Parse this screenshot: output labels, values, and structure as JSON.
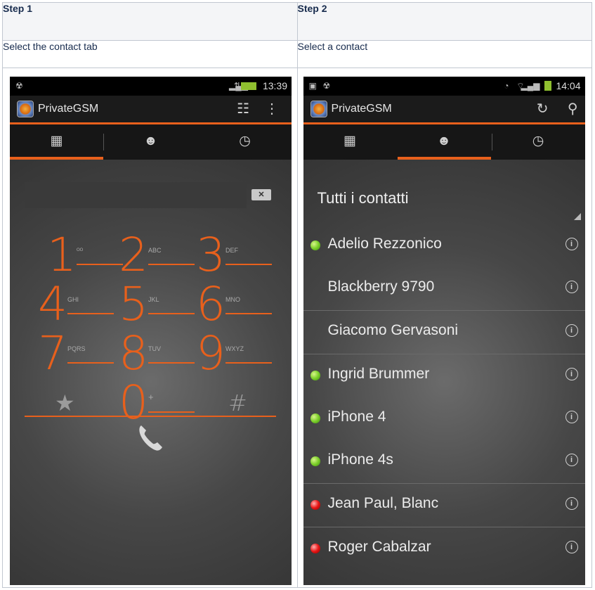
{
  "table": {
    "headers": [
      "Step 1",
      "Step 2"
    ],
    "descriptions": [
      "Select the contact tab",
      "Select a contact"
    ]
  },
  "phone1": {
    "status_time": "13:39",
    "app_title": "PrivateGSM",
    "tabs": [
      "keypad-icon",
      "contact-icon",
      "clock-icon"
    ],
    "selected_tab": 0,
    "backspace": "✕",
    "keys": [
      {
        "digit": "1",
        "letters": "ᴼᴼ"
      },
      {
        "digit": "2",
        "letters": "ABC"
      },
      {
        "digit": "3",
        "letters": "DEF"
      },
      {
        "digit": "4",
        "letters": "GHI"
      },
      {
        "digit": "5",
        "letters": "JKL"
      },
      {
        "digit": "6",
        "letters": "MNO"
      },
      {
        "digit": "7",
        "letters": "PQRS"
      },
      {
        "digit": "8",
        "letters": "TUV"
      },
      {
        "digit": "9",
        "letters": "WXYZ"
      },
      {
        "digit": "★",
        "letters": ""
      },
      {
        "digit": "0",
        "letters": "+"
      },
      {
        "digit": "#",
        "letters": ""
      }
    ],
    "accent": "#e8601c"
  },
  "phone2": {
    "status_time": "14:04",
    "app_title": "PrivateGSM",
    "selected_tab": 1,
    "section_title": "Tutti i contatti",
    "contacts": [
      {
        "name": "Adelio Rezzonico",
        "status": "green"
      },
      {
        "name": "Blackberry 9790",
        "status": "none"
      },
      {
        "name": "Giacomo Gervasoni",
        "status": "none"
      },
      {
        "name": "Ingrid Brummer",
        "status": "green"
      },
      {
        "name": "iPhone 4",
        "status": "green"
      },
      {
        "name": "iPhone 4s",
        "status": "green"
      },
      {
        "name": "Jean Paul, Blanc",
        "status": "red"
      },
      {
        "name": "Roger Cabalzar",
        "status": "red"
      }
    ]
  }
}
